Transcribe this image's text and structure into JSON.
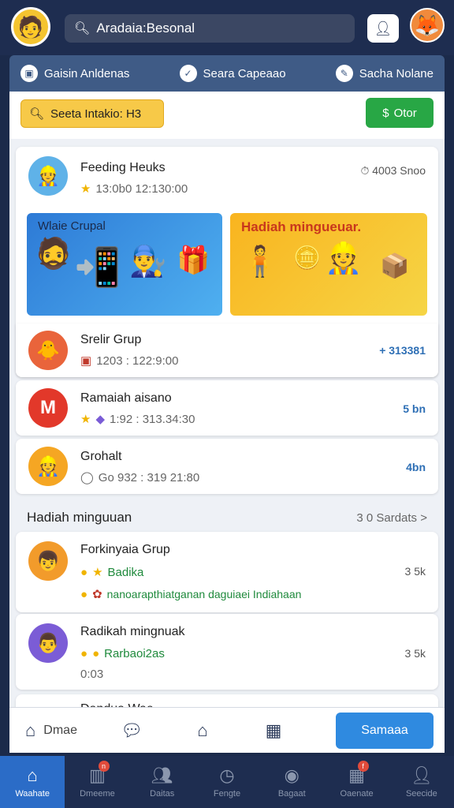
{
  "header": {
    "search_text": "Aradaia:Besonal"
  },
  "categories": [
    {
      "label": "Gaisin Anldenas"
    },
    {
      "label": "Seara Capeaao"
    },
    {
      "label": "Sacha Nolane"
    }
  ],
  "filter": {
    "chip_label": "Seeta Intakio: H3",
    "other_label": "Otor"
  },
  "featured": {
    "title": "Feeding Heuks",
    "meta": "13:0b0 12:130:00",
    "right": "4003 Snoo"
  },
  "banners": [
    {
      "title": "Wlaie Crupal"
    },
    {
      "title": "Hadiah mingueuar."
    }
  ],
  "rows": [
    {
      "title": "Srelir Grup",
      "meta": "1203 : 122:9:00",
      "right": "+ 313381"
    },
    {
      "title": "Ramaiah aisano",
      "meta": "1:92 : 313.34:30",
      "right": "5 bn"
    },
    {
      "title": "Grohalt",
      "meta": "Go 932 : 319 21:80",
      "right": "4bn"
    }
  ],
  "section": {
    "heading": "Hadiah minguuan",
    "more": "3 0 Sardats >"
  },
  "weekly": [
    {
      "title": "Forkinyaia Grup",
      "sub": "Badika",
      "extra": "nanoarapthiatganan daguiaei Indiahaan",
      "right": "3 5k"
    },
    {
      "title": "Radikah mingnuak",
      "sub": "Rarbaoi2as",
      "extra": "0:03",
      "right": "3 5k"
    }
  ],
  "partial_row": {
    "title": "Dandua Wae"
  },
  "actionbar": {
    "first_label": "Dmae",
    "primary_label": "Samaaa"
  },
  "nav": [
    {
      "label": "Waahate"
    },
    {
      "label": "Dmeeme",
      "badge": "n"
    },
    {
      "label": "Daitas"
    },
    {
      "label": "Fengte"
    },
    {
      "label": "Bagaat"
    },
    {
      "label": "Oaenate",
      "badge": "f"
    },
    {
      "label": "Seecide"
    }
  ],
  "colors": {
    "topbar": "#1e2d50",
    "accent": "#2f8ae0",
    "filter_chip": "#f7c948",
    "other_button": "#28a745"
  }
}
